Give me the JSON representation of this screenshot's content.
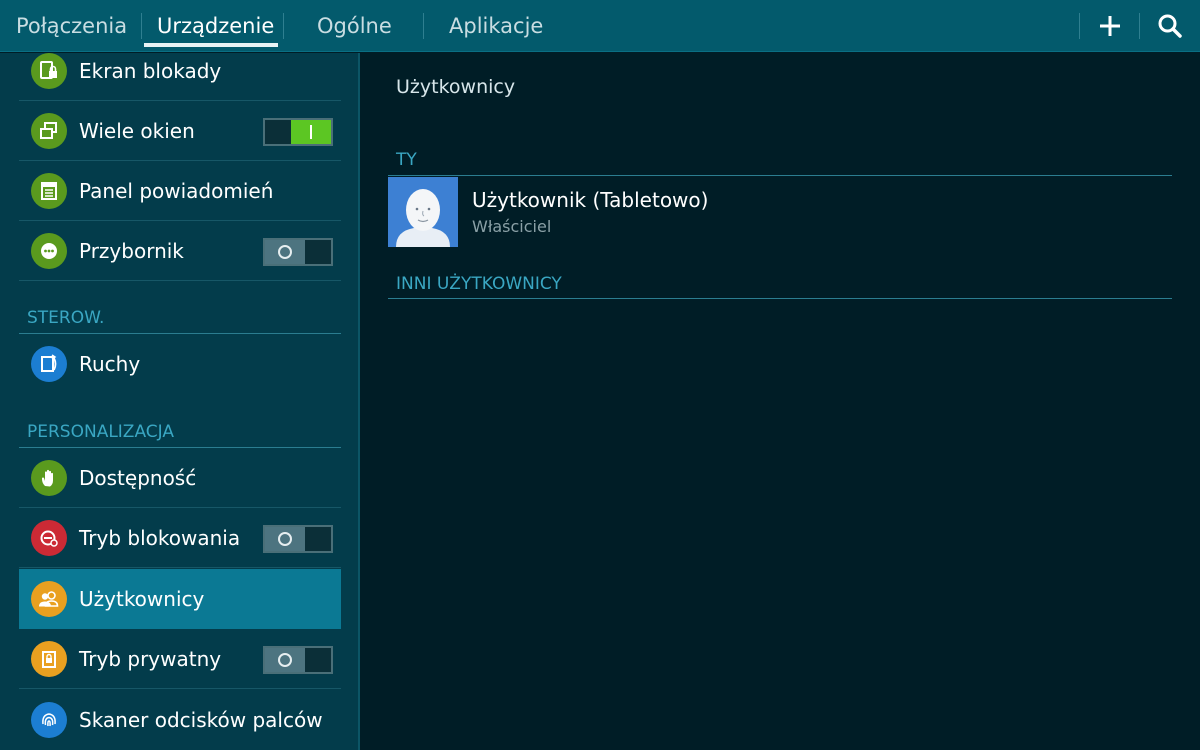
{
  "header": {
    "tabs": [
      {
        "label": "Połączenia",
        "active": false
      },
      {
        "label": "Urządzenie",
        "active": true
      },
      {
        "label": "Ogólne",
        "active": false
      },
      {
        "label": "Aplikacje",
        "active": false
      }
    ],
    "add_icon": "plus-icon",
    "search_icon": "search-icon"
  },
  "sidebar": {
    "items": [
      {
        "label": "Ekran blokady",
        "icon": "lock-screen-icon",
        "icon_color": "#5a9a1e"
      },
      {
        "label": "Wiele okien",
        "icon": "multi-window-icon",
        "icon_color": "#5a9a1e",
        "toggle": "on"
      },
      {
        "label": "Panel powiadomień",
        "icon": "notification-panel-icon",
        "icon_color": "#5a9a1e"
      },
      {
        "label": "Przybornik",
        "icon": "toolbox-icon",
        "icon_color": "#5a9a1e",
        "toggle": "off"
      }
    ],
    "section_sterow": "STEROW.",
    "items_sterow": [
      {
        "label": "Ruchy",
        "icon": "motion-icon",
        "icon_color": "#1c7ed2"
      }
    ],
    "section_personal": "PERSONALIZACJA",
    "items_personal": [
      {
        "label": "Dostępność",
        "icon": "hand-icon",
        "icon_color": "#5a9a1e"
      },
      {
        "label": "Tryb blokowania",
        "icon": "blocking-mode-icon",
        "icon_color": "#cc2a35",
        "toggle": "off"
      },
      {
        "label": "Użytkownicy",
        "icon": "users-icon",
        "icon_color": "#e9a020",
        "selected": true
      },
      {
        "label": "Tryb prywatny",
        "icon": "private-mode-icon",
        "icon_color": "#e9a020",
        "toggle": "off"
      },
      {
        "label": "Skaner odcisków palców",
        "icon": "fingerprint-icon",
        "icon_color": "#1c7ed2"
      }
    ]
  },
  "main": {
    "title": "Użytkownicy",
    "section_you": "TY",
    "user": {
      "name": "Użytkownik (Tabletowo)",
      "role": "Właściciel"
    },
    "section_others": "INNI UŻYTKOWNICY"
  },
  "colors": {
    "topbar": "#035a6c",
    "sidebar": "#033c4b",
    "content": "#001d26",
    "selected": "#0b7994",
    "accent": "#3aa7c3",
    "toggle_on": "#5cc623"
  }
}
